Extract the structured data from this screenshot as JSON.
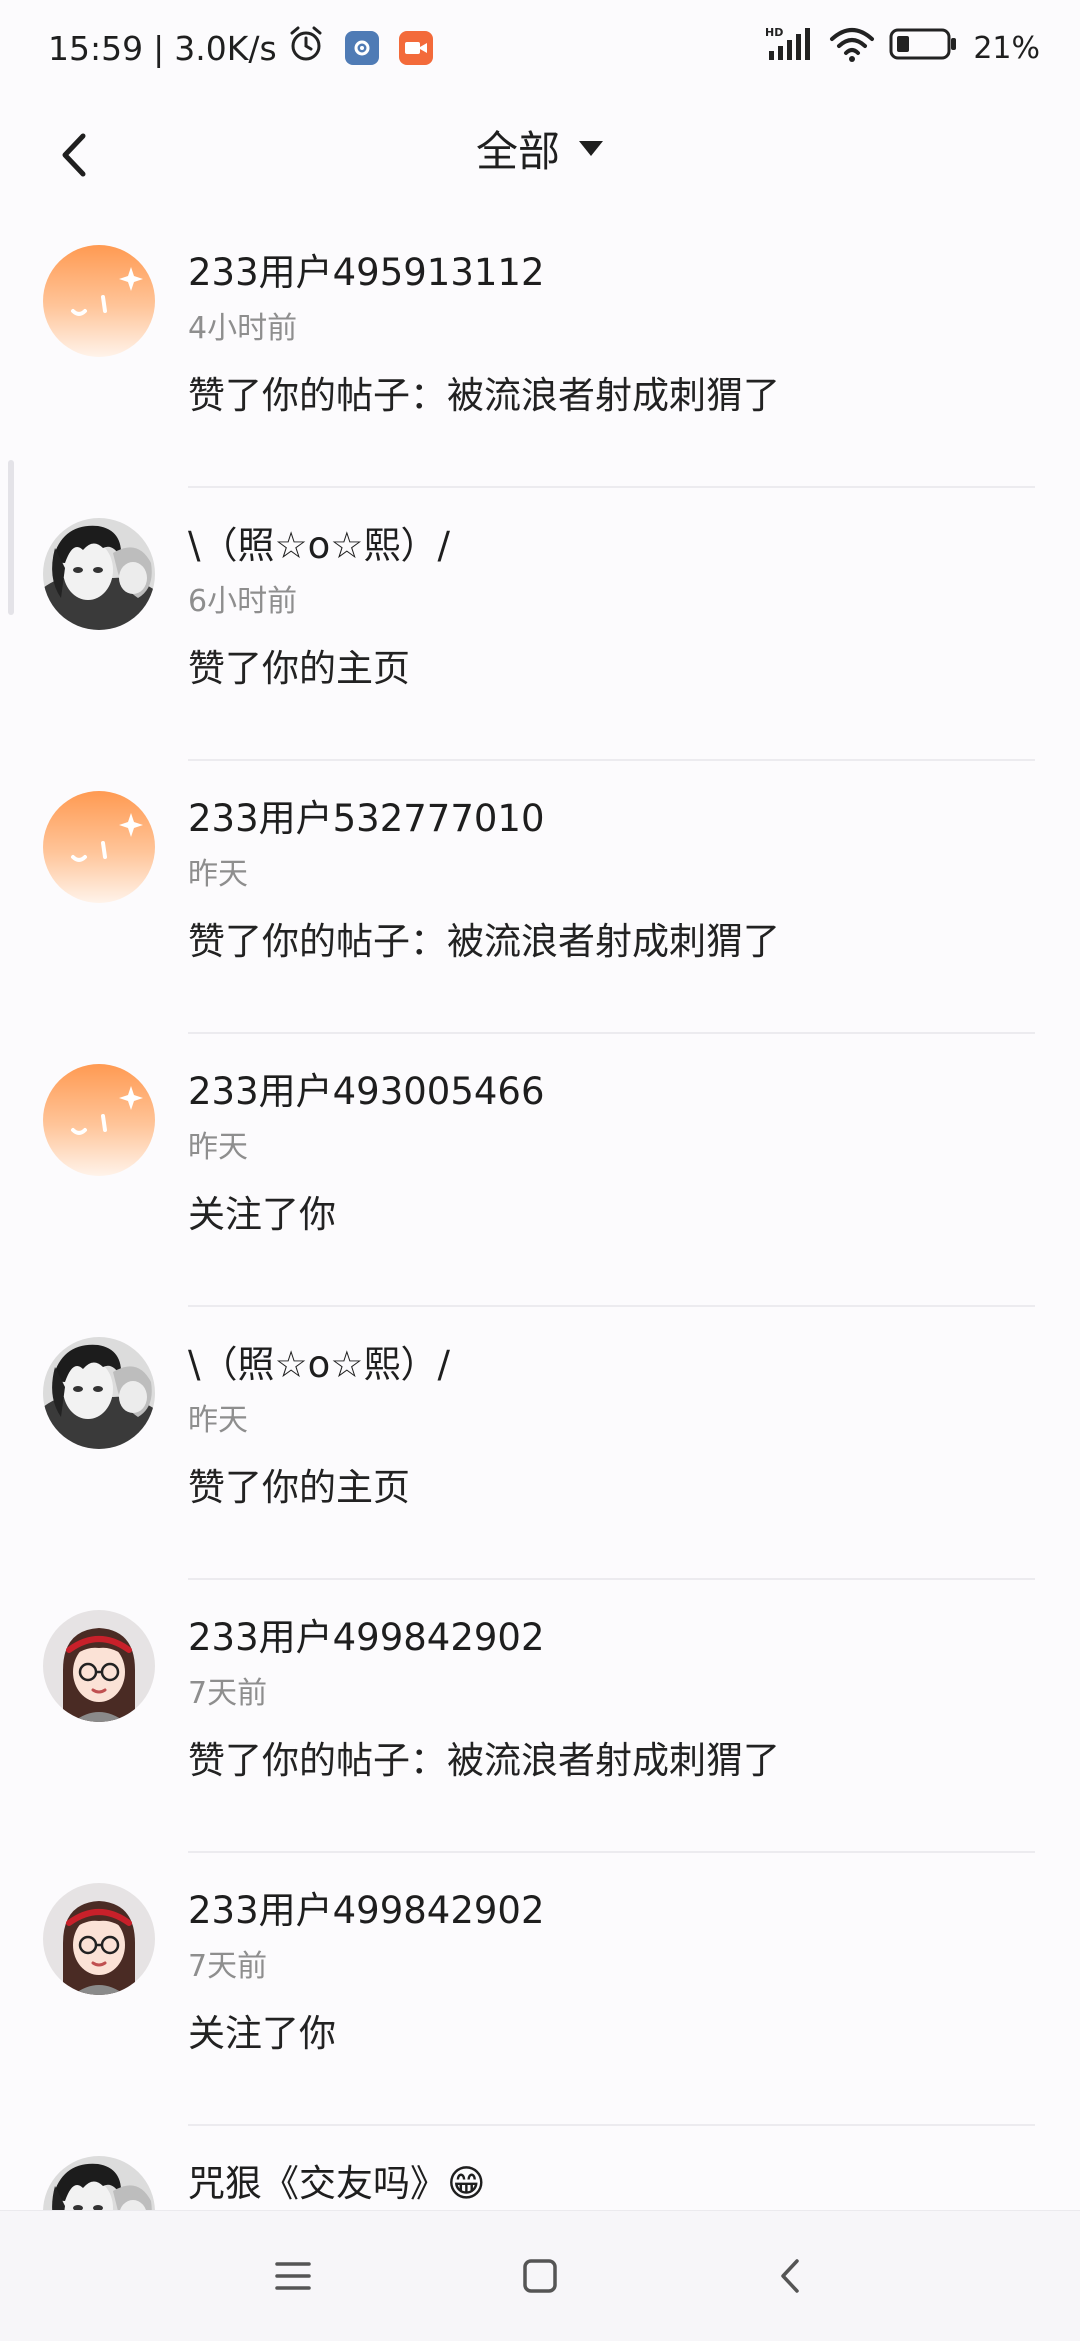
{
  "status_bar": {
    "time": "15:59",
    "separator": "|",
    "net_speed": "3.0K/s",
    "battery": "21%",
    "icons": [
      "alarm-icon",
      "settings-app-icon",
      "video-app-icon",
      "hd-signal-icon",
      "wifi-icon",
      "battery-icon"
    ]
  },
  "header": {
    "back_icon": "chevron-left-icon",
    "filter_label": "全部",
    "filter_icon": "caret-down-icon"
  },
  "colors": {
    "background": "#fcfbfd",
    "avatar_orange": "#ff9a55",
    "secondary_text": "#8e8e8e",
    "divider": "#ecebef"
  },
  "notifications": [
    {
      "user": "233用户495913112",
      "time": "4小时前",
      "action": "赞了你的帖子：被流浪者射成刺猬了",
      "avatar": "default-orange-avatar"
    },
    {
      "user": "\\（照☆o☆熙）/",
      "time": "6小时前",
      "action": "赞了你的主页",
      "avatar": "anime-boy-avatar"
    },
    {
      "user": "233用户532777010",
      "time": "昨天",
      "action": "赞了你的帖子：被流浪者射成刺猬了",
      "avatar": "default-orange-avatar"
    },
    {
      "user": "233用户493005466",
      "time": "昨天",
      "action": "关注了你",
      "avatar": "default-orange-avatar"
    },
    {
      "user": "\\（照☆o☆熙）/",
      "time": "昨天",
      "action": "赞了你的主页",
      "avatar": "anime-boy-avatar"
    },
    {
      "user": "233用户499842902",
      "time": "7天前",
      "action": "赞了你的帖子：被流浪者射成刺猬了",
      "avatar": "cartoon-girl-avatar"
    },
    {
      "user": "233用户499842902",
      "time": "7天前",
      "action": "关注了你",
      "avatar": "cartoon-girl-avatar"
    },
    {
      "user": "咒狠《交友吗》😁",
      "time": "",
      "action": "",
      "avatar": "anime-boy-avatar"
    }
  ],
  "nav_bar": {
    "icons": [
      "menu-icon",
      "home-square-icon",
      "back-triangle-icon"
    ]
  }
}
